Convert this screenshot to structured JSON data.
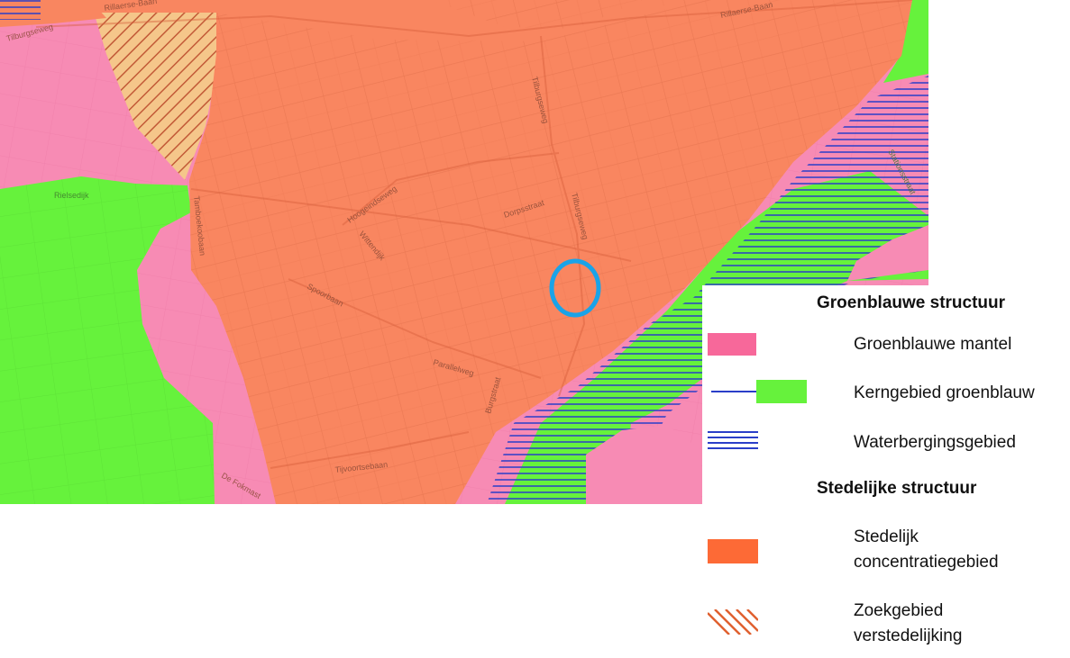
{
  "map": {
    "streets": [
      {
        "id": "rillaerse-baan-1",
        "text": "Rillaerse-Baan"
      },
      {
        "id": "rillaerse-baan-2",
        "text": "Rillaerse-Baan"
      },
      {
        "id": "tilburgseweg-1",
        "text": "Tilburgseweg"
      },
      {
        "id": "tilburgseweg-2",
        "text": "Tilburgseweg"
      },
      {
        "id": "tilburgseweg-3",
        "text": "Tilburgseweg"
      },
      {
        "id": "rielsedijk",
        "text": "Rielsedijk"
      },
      {
        "id": "hoogeindseweg",
        "text": "Hoogeindseweg"
      },
      {
        "id": "dorpsstraat",
        "text": "Dorpsstraat"
      },
      {
        "id": "wilhelminalaan",
        "text": "Wittendijk"
      },
      {
        "id": "tamboekoobaan",
        "text": "Tamboekoobaan"
      },
      {
        "id": "spoorbaan",
        "text": "Spoorbaan"
      },
      {
        "id": "parallelweg",
        "text": "Parallelweg"
      },
      {
        "id": "burgstraat",
        "text": "Burgstraat"
      },
      {
        "id": "tijvoortsebaan",
        "text": "Tijvoortsebaan"
      },
      {
        "id": "de-fokmast",
        "text": "De Fokmast"
      },
      {
        "id": "stationsstraat",
        "text": "Stationsstraat"
      }
    ],
    "marker": {
      "name": "location-circle",
      "color": "#1aa3e8"
    },
    "colors": {
      "mantel": "#f78bb4",
      "kern": "#66f23c",
      "stedelijk": "#f98660",
      "zoek_fill": "#f5c68a",
      "zoek_hatch": "#c25a37",
      "water_lines": "#2a3ec8"
    }
  },
  "legend": {
    "groenblauw": {
      "heading": "Groenblauwe structuur",
      "items": [
        {
          "label": "Groenblauwe mantel",
          "color": "#f7689a"
        },
        {
          "label": "Kerngebied groenblauw",
          "color": "#66f23c",
          "line_color": "#2a3ec8"
        },
        {
          "label": "Waterbergingsgebied",
          "color": "#2a3ec8"
        }
      ]
    },
    "stedelijk": {
      "heading": "Stedelijke structuur",
      "items": [
        {
          "label_line1": "Stedelijk",
          "label_line2": "concentratiegebied",
          "color": "#fd6a36"
        },
        {
          "label_line1": "Zoekgebied",
          "label_line2": "verstedelijking",
          "color": "#e0602f"
        }
      ]
    }
  }
}
